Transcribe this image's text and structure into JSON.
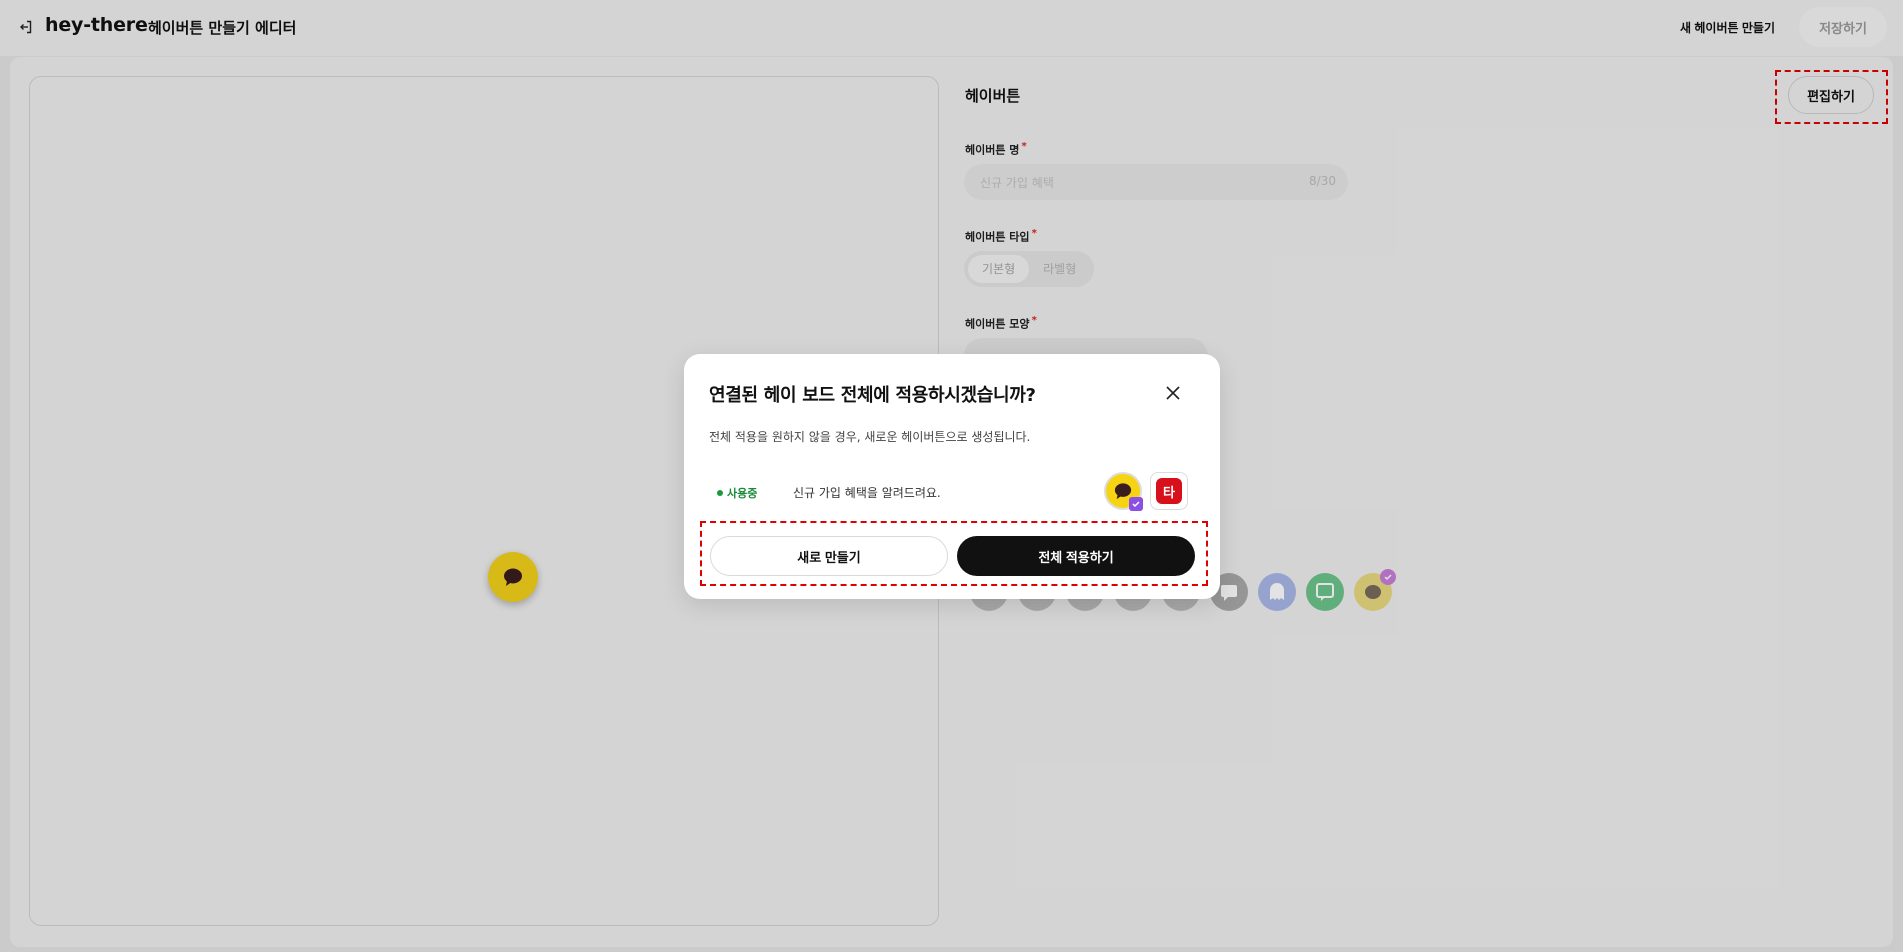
{
  "header": {
    "brand": "hey-there",
    "editor_title": "헤이버튼 만들기 에디터",
    "new_button_label": "새 헤이버튼 만들기",
    "save_button_label": "저장하기"
  },
  "panel": {
    "title": "헤이버튼",
    "edit_button_label": "편집하기",
    "name_label": "헤이버튼 명",
    "name_placeholder": "신규 가입 혜택",
    "name_count": "8/30",
    "type_label": "헤이버튼 타입",
    "type_options": [
      "기본형",
      "라벨형"
    ],
    "shape_label": "헤이버튼 모양",
    "required_mark": "*"
  },
  "modal": {
    "title": "연결된 헤이 보드 전체에 적용하시겠습니까?",
    "description": "전체 적용을 원하지 않을 경우, 새로운 헤이버튼으로 생성됩니다.",
    "status_badge": "사용중",
    "board_text": "신규 가입 혜택을 알려드려요.",
    "thumb_letter": "타",
    "new_button_label": "새로 만들기",
    "apply_button_label": "전체 적용하기"
  },
  "colors": {
    "accent_yellow": "#f2d11b",
    "status_green": "#1a8a3a",
    "primary_black": "#111111",
    "highlight_red": "#e00000",
    "check_purple": "#8b4fe3",
    "badge_red": "#d8101c"
  },
  "icons": [
    "exit-icon",
    "chat-bubble-icon",
    "close-icon",
    "check-icon"
  ]
}
